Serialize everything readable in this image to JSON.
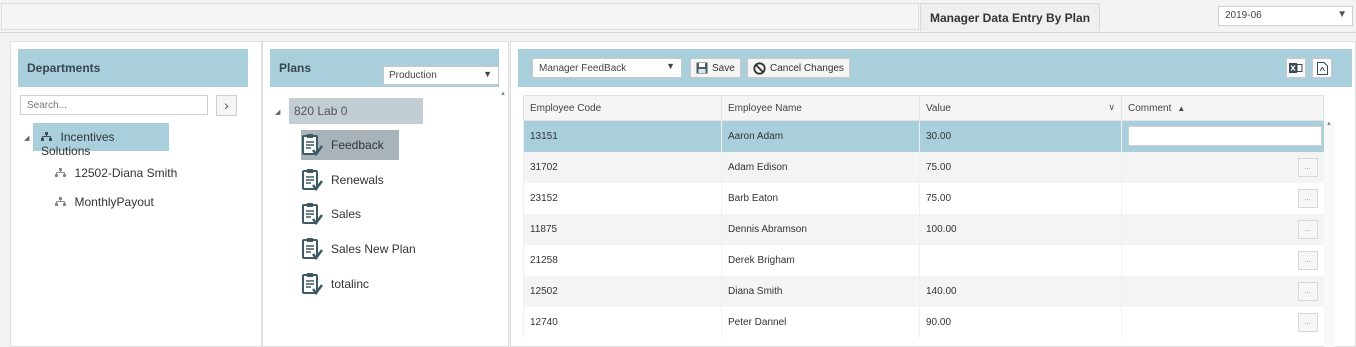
{
  "header": {
    "page_tab": "Manager Data Entry By Plan",
    "period_value": "2019-06"
  },
  "departments": {
    "title": "Departments",
    "search_placeholder": "Search...",
    "root": "Incentives Solutions",
    "children": [
      "12502-Diana Smith",
      "MonthlyPayout"
    ]
  },
  "plans": {
    "title": "Plans",
    "environment": "Production",
    "root": "820 Lab 0",
    "items": [
      "Feedback",
      "Renewals",
      "Sales",
      "Sales New Plan",
      "totalinc"
    ],
    "selected": "Feedback"
  },
  "grid": {
    "view": "Manager FeedBack",
    "save_label": "Save",
    "cancel_label": "Cancel Changes",
    "columns": [
      "Employee Code",
      "Employee Name",
      "Value",
      "Comment"
    ],
    "rows": [
      {
        "code": "13151",
        "name": "Aaron Adam",
        "value": "30.00"
      },
      {
        "code": "31702",
        "name": "Adam Edison",
        "value": "75.00"
      },
      {
        "code": "23152",
        "name": "Barb Eaton",
        "value": "75.00"
      },
      {
        "code": "11875",
        "name": "Dennis Abramson",
        "value": "100.00"
      },
      {
        "code": "21258",
        "name": "Derek Brigham",
        "value": ""
      },
      {
        "code": "12502",
        "name": "Diana Smith",
        "value": "140.00"
      },
      {
        "code": "12740",
        "name": "Peter Dannel",
        "value": "90.00"
      }
    ],
    "ellipsis": "..."
  },
  "icons": {
    "caret_down": "▼",
    "caret_right": "›",
    "tree_expand": "◢",
    "sort_up": "▲",
    "filter": "∨"
  }
}
